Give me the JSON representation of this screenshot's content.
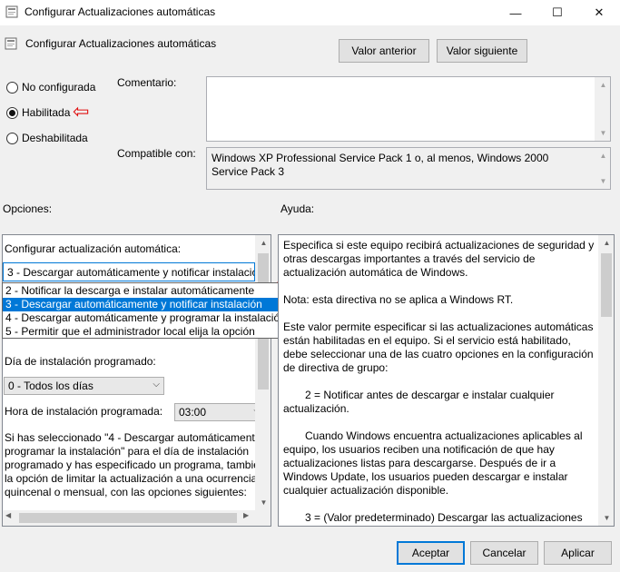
{
  "window": {
    "title": "Configurar Actualizaciones automáticas",
    "minimize_glyph": "—",
    "maximize_glyph": "☐",
    "close_glyph": "✕"
  },
  "header": {
    "title": "Configurar Actualizaciones automáticas",
    "prev_label": "Valor anterior",
    "next_label": "Valor siguiente"
  },
  "state": {
    "options": [
      {
        "label": "No configurada",
        "selected": false
      },
      {
        "label": "Habilitada",
        "selected": true
      },
      {
        "label": "Deshabilitada",
        "selected": false
      }
    ]
  },
  "comment": {
    "label": "Comentario:",
    "value": ""
  },
  "compatible": {
    "label": "Compatible con:",
    "value": "Windows XP Professional Service Pack 1 o, al menos, Windows 2000 Service Pack 3"
  },
  "sections": {
    "options_label": "Opciones:",
    "help_label": "Ayuda:"
  },
  "options_panel": {
    "auto_update_label": "Configurar actualización automática:",
    "auto_update_value": "3 - Descargar automáticamente y notificar instalación",
    "dropdown_items": [
      "2 - Notificar la descarga e instalar automáticamente",
      "3 - Descargar automáticamente y notificar instalación",
      "4 - Descargar automáticamente y programar la instalación",
      "5 - Permitir que el administrador local elija la opción"
    ],
    "dropdown_selected_index": 1,
    "day_label": "Día de instalación programado:",
    "day_value": "0 - Todos los días",
    "time_label": "Hora de instalación programada:",
    "time_value": "03:00",
    "note_lines": [
      "Si has seleccionado \"4 - Descargar automáticamente y",
      "programar la instalación\" para el día de instalación",
      "programado y has especificado un programa, también",
      "la opción de limitar la actualización a una ocurrencia",
      "quincenal o mensual, con las opciones siguientes:"
    ]
  },
  "help": {
    "paragraphs": [
      "Especifica si este equipo recibirá actualizaciones de seguridad y otras descargas importantes a través del servicio de actualización automática de Windows.",
      "Nota: esta directiva no se aplica a Windows RT.",
      "Este valor permite especificar si las actualizaciones automáticas están habilitadas en el equipo. Si el servicio está habilitado, debe seleccionar una de las cuatro opciones en la configuración de directiva de grupo:",
      "2 = Notificar antes de descargar e instalar cualquier actualización.",
      "Cuando Windows encuentra actualizaciones aplicables al equipo, los usuarios reciben una notificación de que hay actualizaciones listas para descargarse. Después de ir a Windows Update, los usuarios pueden descargar e instalar cualquier actualización disponible.",
      "3 = (Valor predeterminado) Descargar las actualizaciones"
    ]
  },
  "footer": {
    "accept_label": "Aceptar",
    "cancel_label": "Cancelar",
    "apply_label": "Aplicar"
  },
  "annotations": {
    "arrow_left": "⇦",
    "arrow_down": "⇩",
    "color": "#e01010"
  }
}
